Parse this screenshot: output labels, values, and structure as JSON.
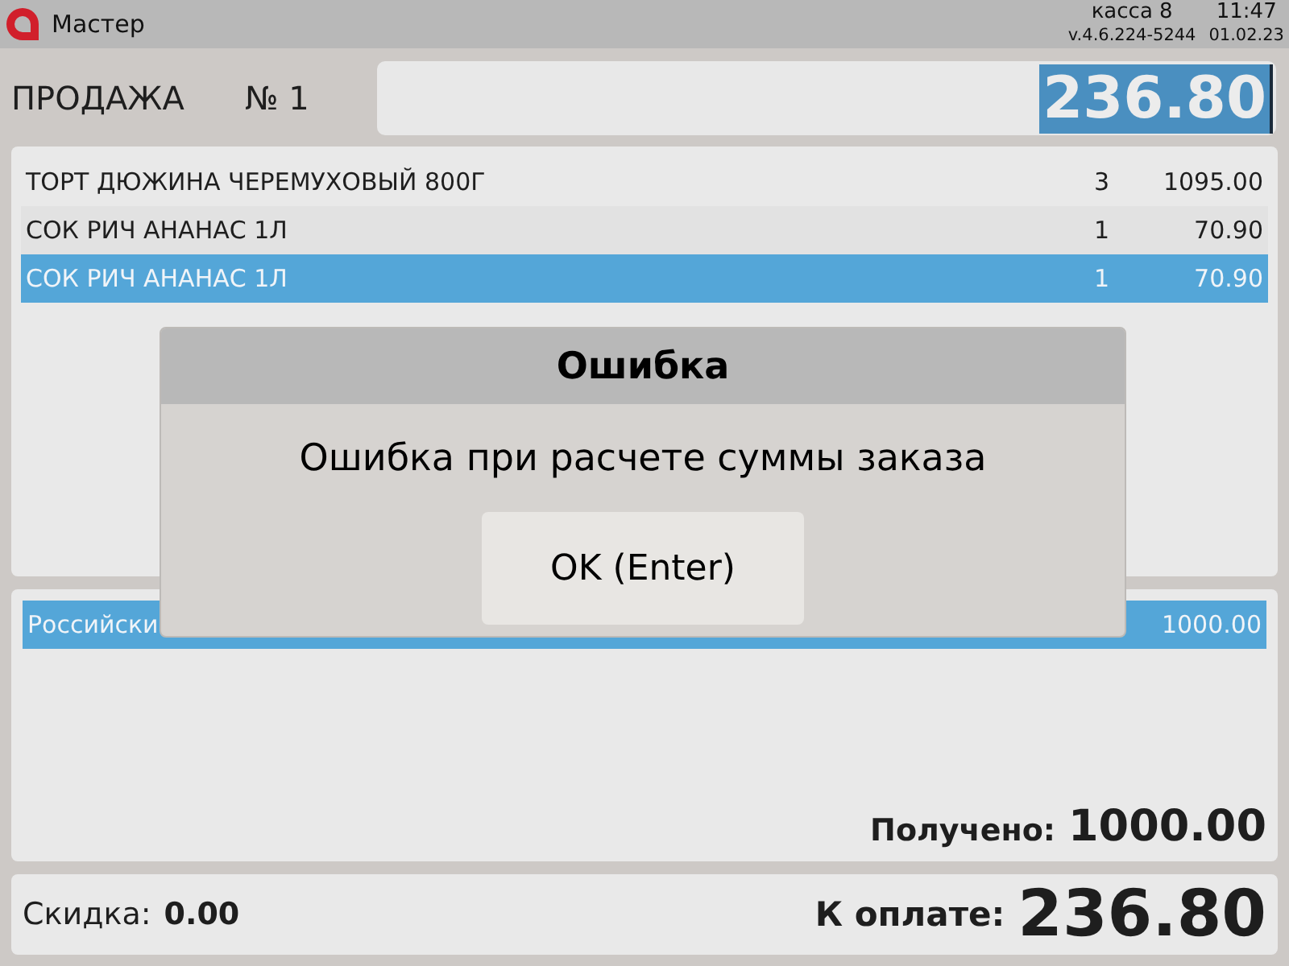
{
  "header": {
    "app_title": "Мастер",
    "register": "касса 8",
    "time": "11:47",
    "version": "v.4.6.224-5244",
    "date": "01.02.23"
  },
  "sale": {
    "label": "ПРОДАЖА",
    "number": "№ 1",
    "total": "236.80"
  },
  "items": [
    {
      "name": "ТОРТ ДЮЖИНА ЧЕРЕМУХОВЫЙ 800Г",
      "qty": "3",
      "sum": "1095.00",
      "selected": false
    },
    {
      "name": "СОК РИЧ АНАНАС 1Л",
      "qty": "1",
      "sum": "70.90",
      "selected": false
    },
    {
      "name": "СОК РИЧ АНАНАС 1Л",
      "qty": "1",
      "sum": "70.90",
      "selected": true
    }
  ],
  "payments": [
    {
      "name": "Российски",
      "amount": "1000.00",
      "selected": true
    }
  ],
  "received": {
    "label": "Получено:",
    "value": "1000.00"
  },
  "footer": {
    "discount_label": "Скидка:",
    "discount": "0.00",
    "due_label": "К оплате:",
    "due": "236.80"
  },
  "dialog": {
    "title": "Ошибка",
    "message": "Ошибка при расчете суммы заказа",
    "button": "OK (Enter)"
  }
}
